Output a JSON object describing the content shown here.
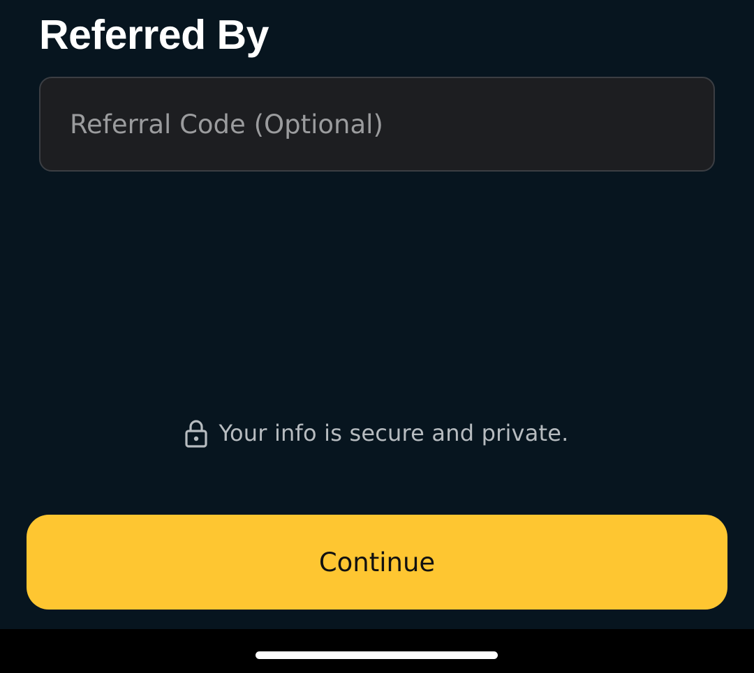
{
  "header": {
    "title": "Referred By"
  },
  "referral": {
    "value": "",
    "placeholder": "Referral Code (Optional)"
  },
  "secure_note": {
    "icon": "lock-icon",
    "text": "Your info is secure and private."
  },
  "actions": {
    "continue_label": "Continue"
  },
  "colors": {
    "background": "#07151f",
    "input_background": "#1d1e21",
    "accent": "#fec631"
  }
}
